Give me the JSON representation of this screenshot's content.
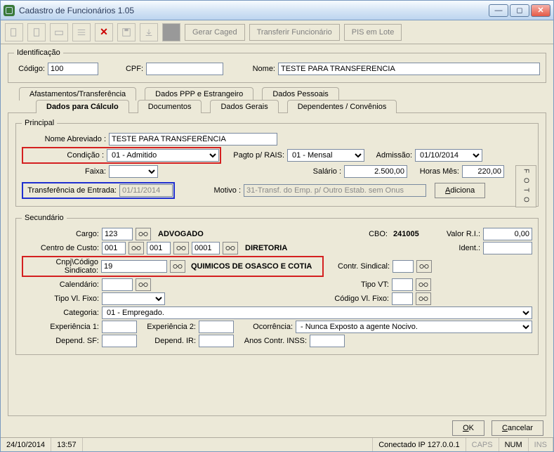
{
  "window": {
    "title": "Cadastro de Funcionários 1.05"
  },
  "toolbar": {
    "gerar_caged": "Gerar Caged",
    "transferir": "Transferir Funcionário",
    "pis_lote": "PIS em Lote"
  },
  "ident": {
    "legend": "Identificação",
    "codigo_label": "Código:",
    "codigo": "100",
    "cpf_label": "CPF:",
    "cpf": "",
    "nome_label": "Nome:",
    "nome": "TESTE PARA TRANSFERENCIA"
  },
  "tabs": {
    "row1": {
      "afast": "Afastamentos/Transferência",
      "ppp": "Dados PPP e Estrangeiro",
      "pessoais": "Dados Pessoais"
    },
    "row2": {
      "calculo": "Dados para Cálculo",
      "documentos": "Documentos",
      "gerais": "Dados Gerais",
      "dep": "Dependentes / Convênios"
    }
  },
  "principal": {
    "legend": "Principal",
    "nome_abrev_label": "Nome Abreviado :",
    "nome_abrev": "TESTE PARA TRANSFERÊNCIA",
    "condicao_label": "Condição :",
    "condicao": "01 - Admitido",
    "pagto_label": "Pagto p/ RAIS:",
    "pagto": "01 - Mensal",
    "admissao_label": "Admissão:",
    "admissao": "01/10/2014",
    "faixa_label": "Faixa:",
    "salario_label": "Salário :",
    "salario": "2.500,00",
    "horas_label": "Horas Mês:",
    "horas": "220,00",
    "transf_label": "Transferência de Entrada:",
    "transf": "01/11/2014",
    "motivo_label": "Motivo :",
    "motivo": "31-Transf. do Emp. p/ Outro Estab. sem Onus",
    "adiciona_btn": "Adiciona",
    "foto": "F O T O"
  },
  "secundario": {
    "legend": "Secundário",
    "cargo_label": "Cargo:",
    "cargo": "123",
    "cargo_desc": "ADVOGADO",
    "cbo_label": "CBO:",
    "cbo": "241005",
    "valor_ri_label": "Valor R.I.:",
    "valor_ri": "0,00",
    "cc_label": "Centro de Custo:",
    "cc1": "001",
    "cc2": "001",
    "cc3": "0001",
    "cc_desc": "DIRETORIA",
    "ident_label": "Ident.:",
    "ident": "",
    "sind_label": "Cnpj\\Código Sindicato:",
    "sind": "19",
    "sind_desc": "QUIMICOS DE OSASCO E COTIA",
    "contr_sind_label": "Contr. Sindical:",
    "cal_label": "Calendário:",
    "tipo_vt_label": "Tipo VT:",
    "tipo_vf_label": "Tipo Vl. Fixo:",
    "cod_vf_label": "Código Vl. Fixo:",
    "categoria_label": "Categoria:",
    "categoria": "01 - Empregado.",
    "exp1_label": "Experiência 1:",
    "exp2_label": "Experiência 2:",
    "ocorr_label": "Ocorrência:",
    "ocorr": " - Nunca Exposto a agente Nocivo.",
    "dep_sf_label": "Depend. SF:",
    "dep_ir_label": "Depend. IR:",
    "anos_inss_label": "Anos Contr. INSS:"
  },
  "footer": {
    "ok": "OK",
    "cancel": "Cancelar"
  },
  "status": {
    "date": "24/10/2014",
    "time": "13:57",
    "conn": "Conectado IP 127.0.0.1",
    "caps": "CAPS",
    "num": "NUM",
    "ins": "INS"
  }
}
